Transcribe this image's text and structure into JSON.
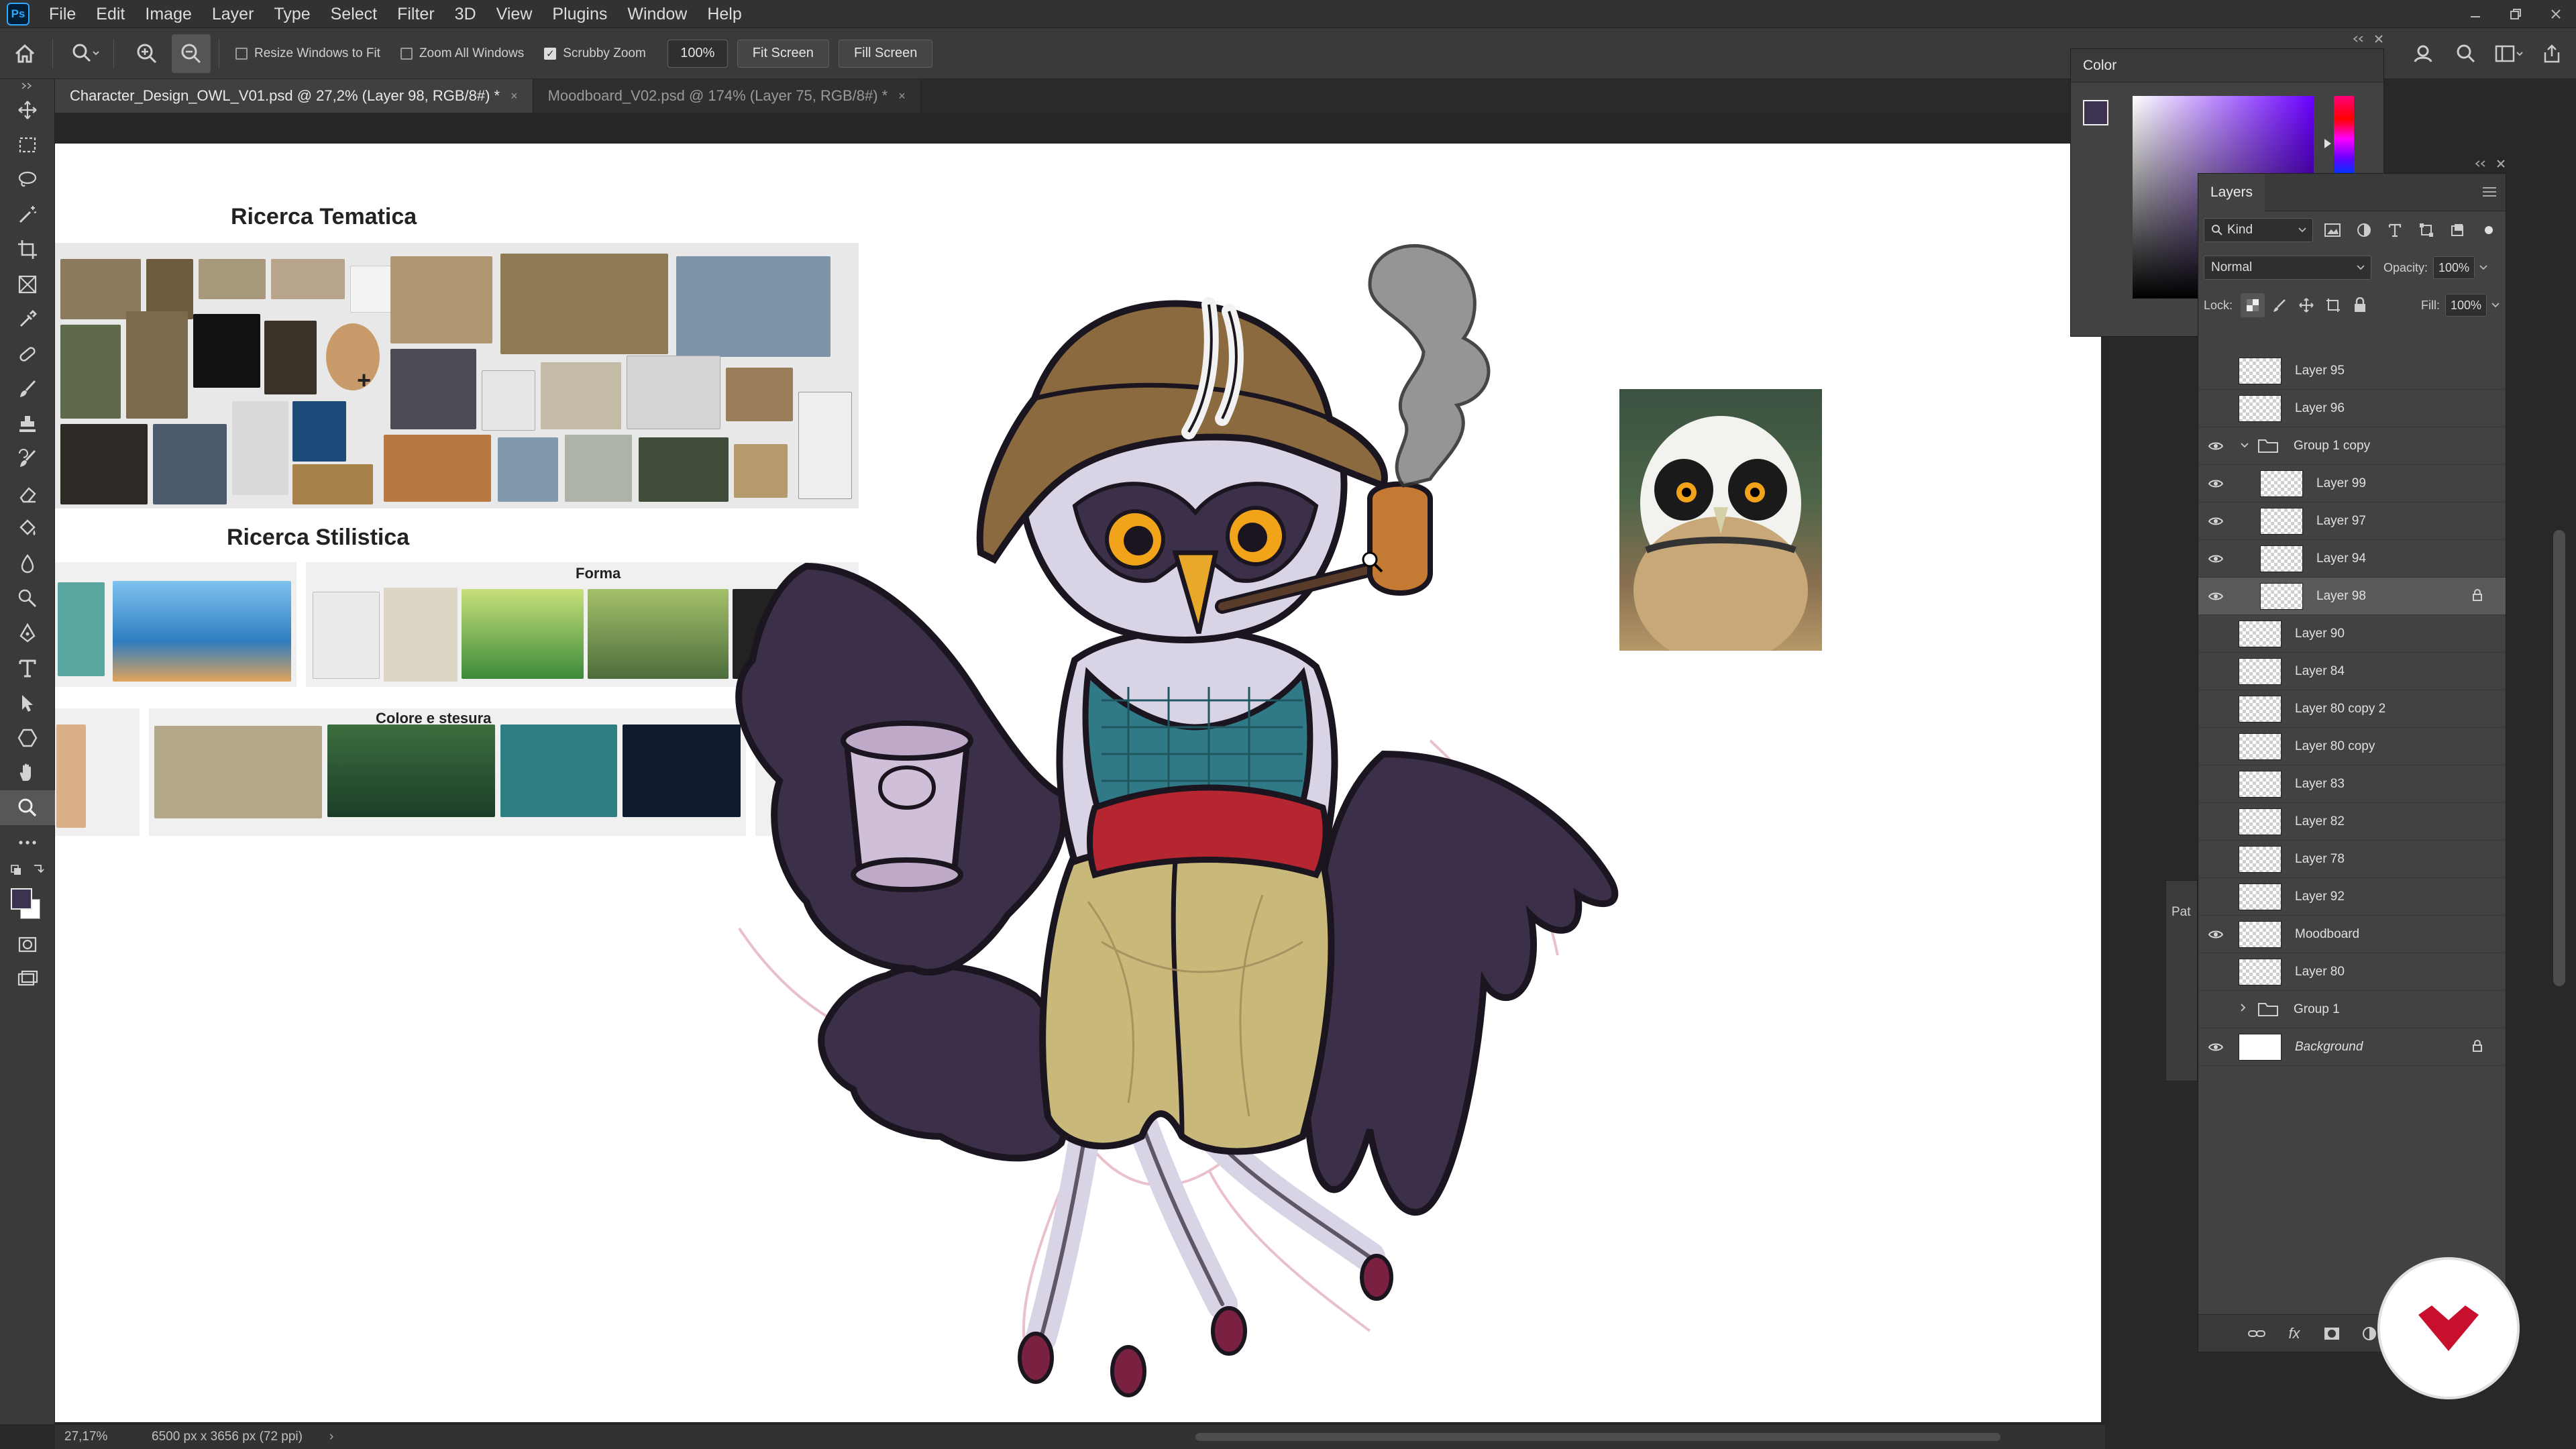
{
  "app": {
    "logo": "Ps",
    "menu": [
      "File",
      "Edit",
      "Image",
      "Layer",
      "Type",
      "Select",
      "Filter",
      "3D",
      "View",
      "Plugins",
      "Window",
      "Help"
    ]
  },
  "options_bar": {
    "resize_windows": "Resize Windows to Fit",
    "zoom_all": "Zoom All Windows",
    "scrubby_zoom": "Scrubby Zoom",
    "zoom_value": "100%",
    "fit_screen": "Fit Screen",
    "fill_screen": "Fill Screen",
    "scrubby_checked": true
  },
  "tabs": [
    {
      "label": "Character_Design_OWL_V01.psd @ 27,2% (Layer 98, RGB/8#) *",
      "active": true
    },
    {
      "label": "Moodboard_V02.psd @ 174% (Layer 75, RGB/8#) *",
      "active": false
    }
  ],
  "tab_close": "×",
  "canvas": {
    "moodboard": {
      "ricerca_tematica": "Ricerca Tematica",
      "ricerca_stilistica": "Ricerca Stilistica",
      "forma": "Forma",
      "colore": "Colore e stesura",
      "plus": "+"
    }
  },
  "status": {
    "zoom": "27,17%",
    "doc": "6500 px x 3656 px (72 ppi)",
    "arrow": "›"
  },
  "color_panel": {
    "title": "Color",
    "fg_color": "#3d3350",
    "bg_color": "#ffffff"
  },
  "layers_panel": {
    "title": "Layers",
    "filter_kind": "Kind",
    "blend_mode": "Normal",
    "opacity_label": "Opacity:",
    "opacity_value": "100%",
    "lock_label": "Lock:",
    "fill_label": "Fill:",
    "fill_value": "100%",
    "layers": [
      {
        "name": "Layer 95",
        "visible": false,
        "type": "layer"
      },
      {
        "name": "Layer 96",
        "visible": false,
        "type": "layer"
      },
      {
        "name": "Group 1 copy",
        "visible": true,
        "type": "group",
        "expanded": true
      },
      {
        "name": "Layer 99",
        "visible": true,
        "type": "child"
      },
      {
        "name": "Layer 97",
        "visible": true,
        "type": "child"
      },
      {
        "name": "Layer 94",
        "visible": true,
        "type": "child"
      },
      {
        "name": "Layer 98",
        "visible": true,
        "type": "child",
        "selected": true,
        "locked": true
      },
      {
        "name": "Layer 90",
        "visible": false,
        "type": "layer"
      },
      {
        "name": "Layer 84",
        "visible": false,
        "type": "layer"
      },
      {
        "name": "Layer 80 copy 2",
        "visible": false,
        "type": "layer"
      },
      {
        "name": "Layer 80 copy",
        "visible": false,
        "type": "layer"
      },
      {
        "name": "Layer 83",
        "visible": false,
        "type": "layer"
      },
      {
        "name": "Layer 82",
        "visible": false,
        "type": "layer"
      },
      {
        "name": "Layer 78",
        "visible": false,
        "type": "layer"
      },
      {
        "name": "Layer 92",
        "visible": false,
        "type": "layer"
      },
      {
        "name": "Moodboard",
        "visible": true,
        "type": "layer"
      },
      {
        "name": "Layer 80",
        "visible": false,
        "type": "layer"
      },
      {
        "name": "Group 1",
        "visible": false,
        "type": "group",
        "expanded": false
      },
      {
        "name": "Background",
        "visible": true,
        "type": "background",
        "locked": true
      }
    ],
    "footer_fx": "fx"
  },
  "paths_panel": {
    "label": "Pat"
  },
  "colors": {
    "owl_purple": "#3b2f4a",
    "owl_light": "#d9d3e6",
    "hat": "#8a6a3e",
    "vest": "#2f7a86",
    "sash": "#b52630",
    "pants": "#c8b87a",
    "logo_red": "#c8102e"
  }
}
